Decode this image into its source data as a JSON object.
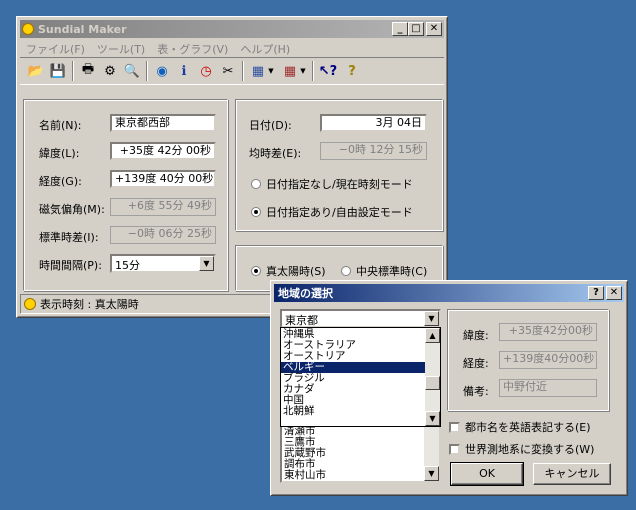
{
  "main": {
    "title": "Sundial Maker",
    "menu": [
      "ファイル(F)",
      "ツール(T)",
      "表・グラフ(V)",
      "ヘルプ(H)"
    ],
    "toolbar_icons": [
      "open-icon",
      "save-icon",
      "print-icon",
      "print-setup-icon",
      "print-preview-icon",
      "globe-icon",
      "info-icon",
      "clock-icon",
      "tools-icon",
      "grid-icon",
      "grid-dropdown-icon",
      "grid-alt-icon",
      "grid-alt-dropdown-icon",
      "help-pointer-icon",
      "question-icon"
    ],
    "location": {
      "name_label": "名前(N):",
      "name_value": "東京都西部",
      "lat_label": "緯度(L):",
      "lat_value": "+35度 42分 00秒",
      "lon_label": "経度(G):",
      "lon_value": "+139度 40分 00秒",
      "decl_label": "磁気偏角(M):",
      "decl_value": "+6度 55分 49秒",
      "stdtime_label": "標準時差(I):",
      "stdtime_value": "−0時 06分 25秒",
      "interval_label": "時間間隔(P):",
      "interval_value": "15分"
    },
    "date": {
      "date_label": "日付(D):",
      "date_value": "3月 04日",
      "eqtime_label": "均時差(E):",
      "eqtime_value": "−0時 12分 15秒",
      "radio_now": "日付指定なし/現在時刻モード",
      "radio_free": "日付指定あり/自由設定モード",
      "selected": "free"
    },
    "time_mode": {
      "true_solar": "真太陽時(S)",
      "mean_solar": "中央標準時(C)",
      "selected": "true_solar"
    },
    "status": "表示時刻 : 真太陽時"
  },
  "dialog": {
    "title": "地域の選択",
    "combo_value": "東京都",
    "dropdown_items": [
      "沖縄県",
      "オーストラリア",
      "オーストリア",
      "ベルギー",
      "ブラジル",
      "カナダ",
      "中国",
      "北朝鮮"
    ],
    "dropdown_selected_index": 3,
    "city_items": [
      "清瀬市",
      "三鷹市",
      "武蔵野市",
      "調布市",
      "東村山市"
    ],
    "lat_label": "緯度:",
    "lat_value": "+35度42分00秒",
    "lon_label": "経度:",
    "lon_value": "+139度40分00秒",
    "note_label": "備考:",
    "note_value": "中野付近",
    "check_english": "都市名を英語表記する(E)",
    "check_world": "世界測地系に変換する(W)",
    "ok": "OK",
    "cancel": "キャンセル"
  }
}
